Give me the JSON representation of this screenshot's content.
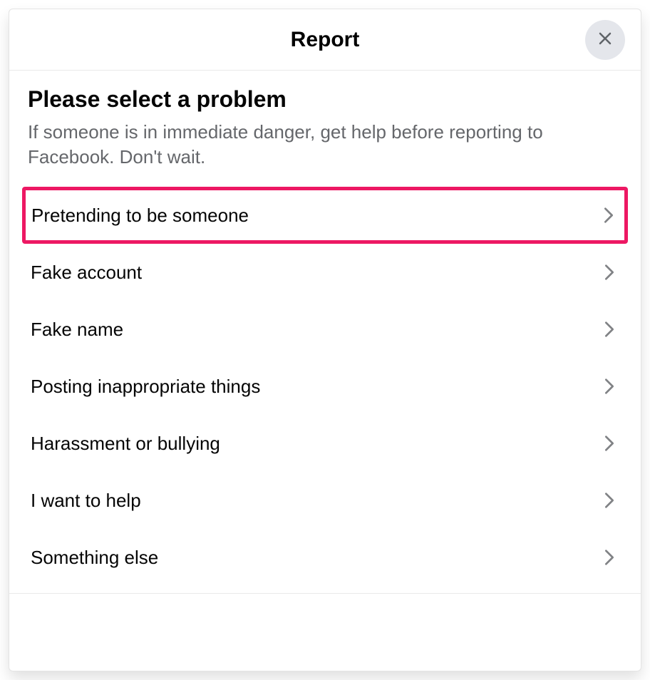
{
  "header": {
    "title": "Report"
  },
  "subheader": {
    "title": "Please select a problem",
    "description": "If someone is in immediate danger, get help before reporting to Facebook. Don't wait."
  },
  "options": [
    {
      "label": "Pretending to be someone",
      "highlighted": true
    },
    {
      "label": "Fake account",
      "highlighted": false
    },
    {
      "label": "Fake name",
      "highlighted": false
    },
    {
      "label": "Posting inappropriate things",
      "highlighted": false
    },
    {
      "label": "Harassment or bullying",
      "highlighted": false
    },
    {
      "label": "I want to help",
      "highlighted": false
    },
    {
      "label": "Something else",
      "highlighted": false
    }
  ],
  "colors": {
    "highlight": "#ed1863"
  }
}
